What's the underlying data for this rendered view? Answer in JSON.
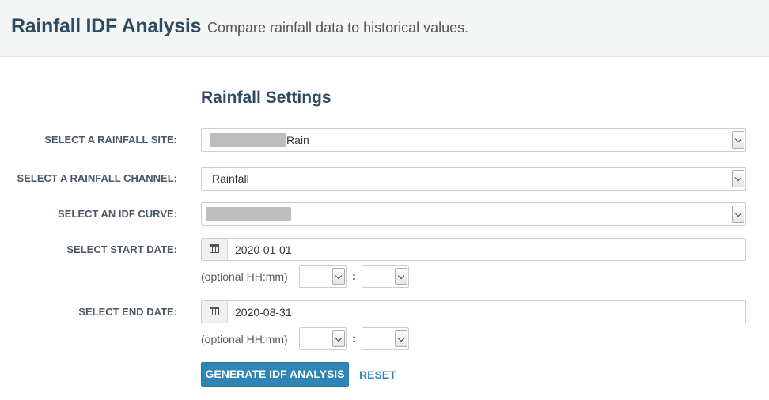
{
  "header": {
    "title": "Rainfall IDF Analysis",
    "subtitle": "Compare rainfall data to historical values."
  },
  "section": {
    "title": "Rainfall Settings"
  },
  "form": {
    "site": {
      "label": "SELECT A RAINFALL SITE:",
      "value": "Rain"
    },
    "channel": {
      "label": "SELECT A RAINFALL CHANNEL:",
      "value": "Rainfall"
    },
    "idf_curve": {
      "label": "SELECT AN IDF CURVE:",
      "value": ""
    },
    "start_date": {
      "label": "SELECT START DATE:",
      "value": "2020-01-01",
      "optional_label": "(optional HH:mm)",
      "separator": ":"
    },
    "end_date": {
      "label": "SELECT END DATE:",
      "value": "2020-08-31",
      "optional_label": "(optional HH:mm)",
      "separator": ":"
    }
  },
  "actions": {
    "generate_label": "GENERATE IDF ANALYSIS",
    "reset_label": "RESET"
  },
  "colors": {
    "title": "#2f4b64",
    "primary": "#2f86b6",
    "header_bg": "#f4f5f5"
  }
}
